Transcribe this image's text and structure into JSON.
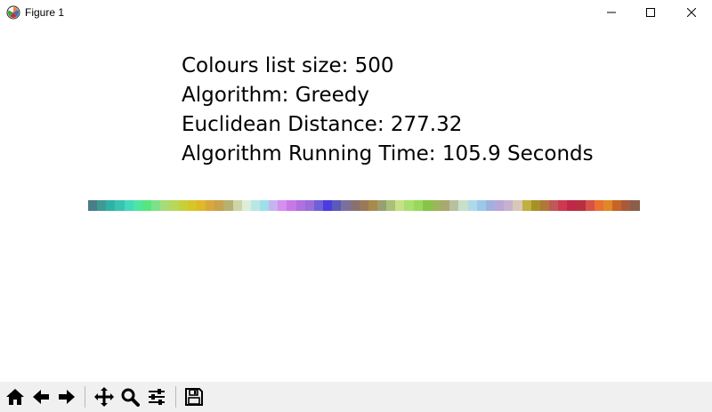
{
  "window": {
    "title": "Figure 1",
    "icon": "matplotlib-icon",
    "controls": [
      "minimize-icon",
      "maximize-icon",
      "close-icon"
    ]
  },
  "figure": {
    "lines": [
      "Colours list size: 500",
      "Algorithm: Greedy",
      "Euclidean Distance: 277.32",
      "Algorithm Running Time: 105.9 Seconds"
    ],
    "color_strip": [
      "#4a7c8a",
      "#3f9a93",
      "#2fb2a6",
      "#39c4b0",
      "#45d9c0",
      "#4ee6a0",
      "#55e67e",
      "#7fe08a",
      "#a5dc7a",
      "#b8d85a",
      "#c8d038",
      "#d9c525",
      "#e0b82a",
      "#d8a83a",
      "#c8a24c",
      "#b8b070",
      "#cfd4a8",
      "#ddeed8",
      "#b9e8e4",
      "#9de0ea",
      "#c6b4f0",
      "#d88ef0",
      "#c878e6",
      "#b070e0",
      "#9c6cd8",
      "#7060d8",
      "#4a3ce0",
      "#5a5ab8",
      "#7a70a0",
      "#8a7070",
      "#9a7858",
      "#a88a4a",
      "#98a070",
      "#a8c078",
      "#c8e088",
      "#a8e070",
      "#98d85a",
      "#88c448",
      "#9ab858",
      "#a8a870",
      "#b8c0a0",
      "#c8e0c8",
      "#b0d8e8",
      "#9cc8e8",
      "#a0b0e0",
      "#b8a8d8",
      "#c8b0d0",
      "#d8c8b8",
      "#c0b040",
      "#a89028",
      "#b07838",
      "#c05858",
      "#d03850",
      "#c02848",
      "#b83040",
      "#d85048",
      "#e87030",
      "#e08828",
      "#c86428",
      "#a85a3a",
      "#8a5e48"
    ]
  },
  "toolbar": {
    "buttons": [
      "home-icon",
      "back-icon",
      "forward-icon",
      "pan-icon",
      "zoom-icon",
      "configure-subplots-icon",
      "save-icon"
    ]
  }
}
